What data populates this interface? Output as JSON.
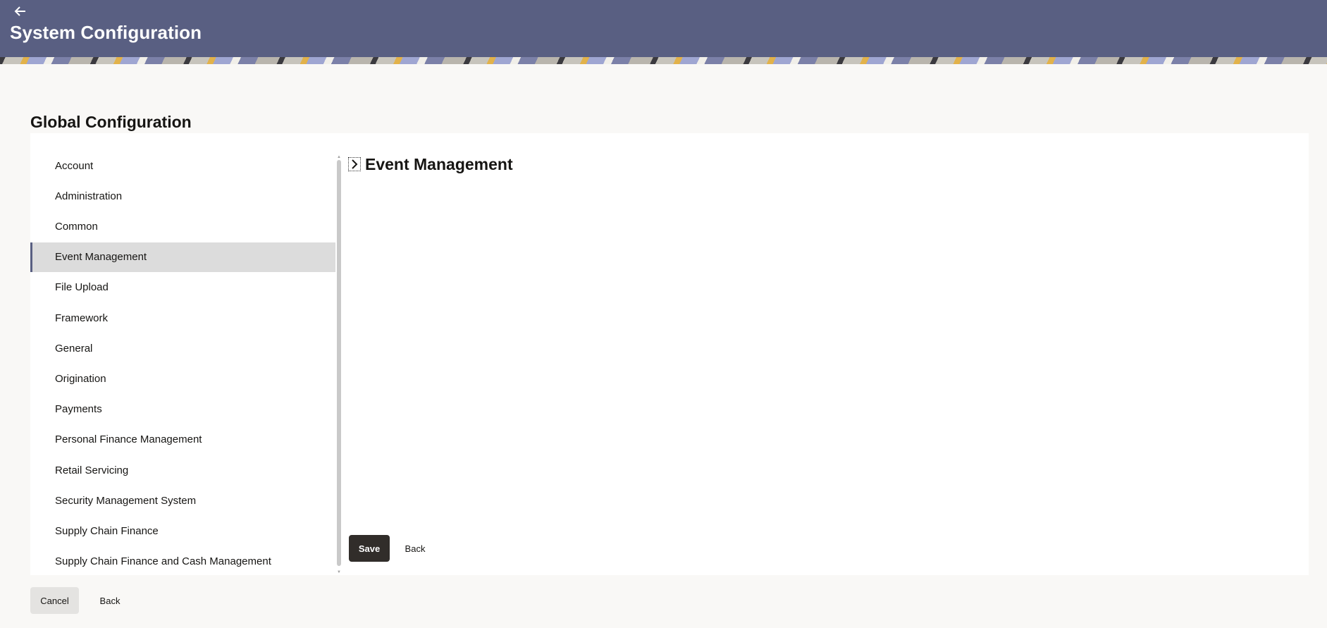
{
  "header": {
    "title": "System Configuration",
    "back_icon": "arrow-left-icon",
    "background_color": "#595f82"
  },
  "page": {
    "heading": "Global Configuration"
  },
  "sidebar": {
    "active_index": 3,
    "items": [
      {
        "label": "Account"
      },
      {
        "label": "Administration"
      },
      {
        "label": "Common"
      },
      {
        "label": "Event Management"
      },
      {
        "label": "File Upload"
      },
      {
        "label": "Framework"
      },
      {
        "label": "General"
      },
      {
        "label": "Origination"
      },
      {
        "label": "Payments"
      },
      {
        "label": "Personal Finance Management"
      },
      {
        "label": "Retail Servicing"
      },
      {
        "label": "Security Management System"
      },
      {
        "label": "Supply Chain Finance"
      },
      {
        "label": "Supply Chain Finance and Cash Management"
      }
    ]
  },
  "content": {
    "title": "Event Management",
    "toggle_icon": "chevron-right-icon",
    "save_label": "Save",
    "back_label": "Back"
  },
  "footer": {
    "cancel_label": "Cancel",
    "back_label": "Back"
  },
  "colors": {
    "primary_button": "#312d2a",
    "active_item_bg": "#dcdcdc",
    "page_bg": "#f9f8f6"
  }
}
